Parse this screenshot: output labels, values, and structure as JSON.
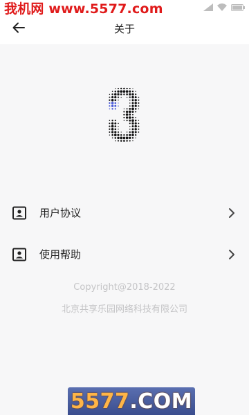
{
  "watermark_top": "我机网 www.5577.com",
  "watermark_bottom": {
    "a": "5577",
    "b": ".COM"
  },
  "status_bar": {
    "icons": [
      "signal-icon",
      "wifi-icon",
      "battery-icon"
    ]
  },
  "appbar": {
    "title": "关于",
    "back_icon": "arrow-left-icon"
  },
  "menu": [
    {
      "label": "用户协议",
      "icon": "id-card-icon"
    },
    {
      "label": "使用帮助",
      "icon": "id-card-icon"
    }
  ],
  "footer": {
    "copyright": "Copyright@2018-2022",
    "company": "北京共享乐园网络科技有限公司"
  },
  "colors": {
    "background": "#f7f7f8",
    "text": "#222222",
    "footer_text": "#c4c4c6",
    "logo_dots": "#111111",
    "logo_accent": "#4a5bd8"
  }
}
